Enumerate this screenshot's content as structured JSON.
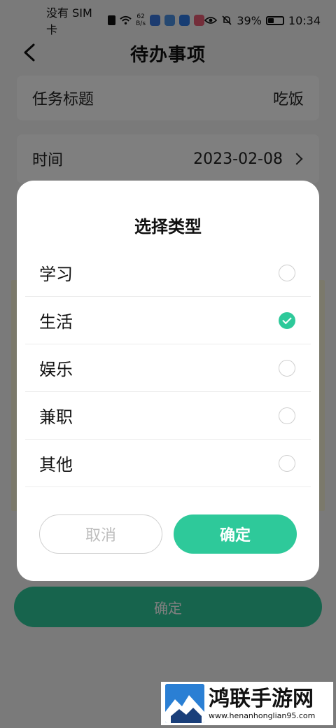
{
  "status_bar": {
    "carrier": "没有 SIM 卡",
    "net_speed_value": "62",
    "net_speed_unit": "B/s",
    "battery": "39%",
    "time": "10:34"
  },
  "header": {
    "title": "待办事项"
  },
  "form": {
    "title_label": "任务标题",
    "title_value": "吃饭",
    "time_label": "时间",
    "time_value": "2023-02-08"
  },
  "bottom_button": {
    "label": "确定"
  },
  "dialog": {
    "title": "选择类型",
    "options": [
      {
        "label": "学习",
        "checked": false
      },
      {
        "label": "生活",
        "checked": true
      },
      {
        "label": "娱乐",
        "checked": false
      },
      {
        "label": "兼职",
        "checked": false
      },
      {
        "label": "其他",
        "checked": false
      }
    ],
    "cancel_label": "取消",
    "confirm_label": "确定"
  },
  "watermark": {
    "name": "鸿联手游网",
    "url": "www.henanhonglian95.com"
  },
  "colors": {
    "accent": "#2ec99a"
  }
}
